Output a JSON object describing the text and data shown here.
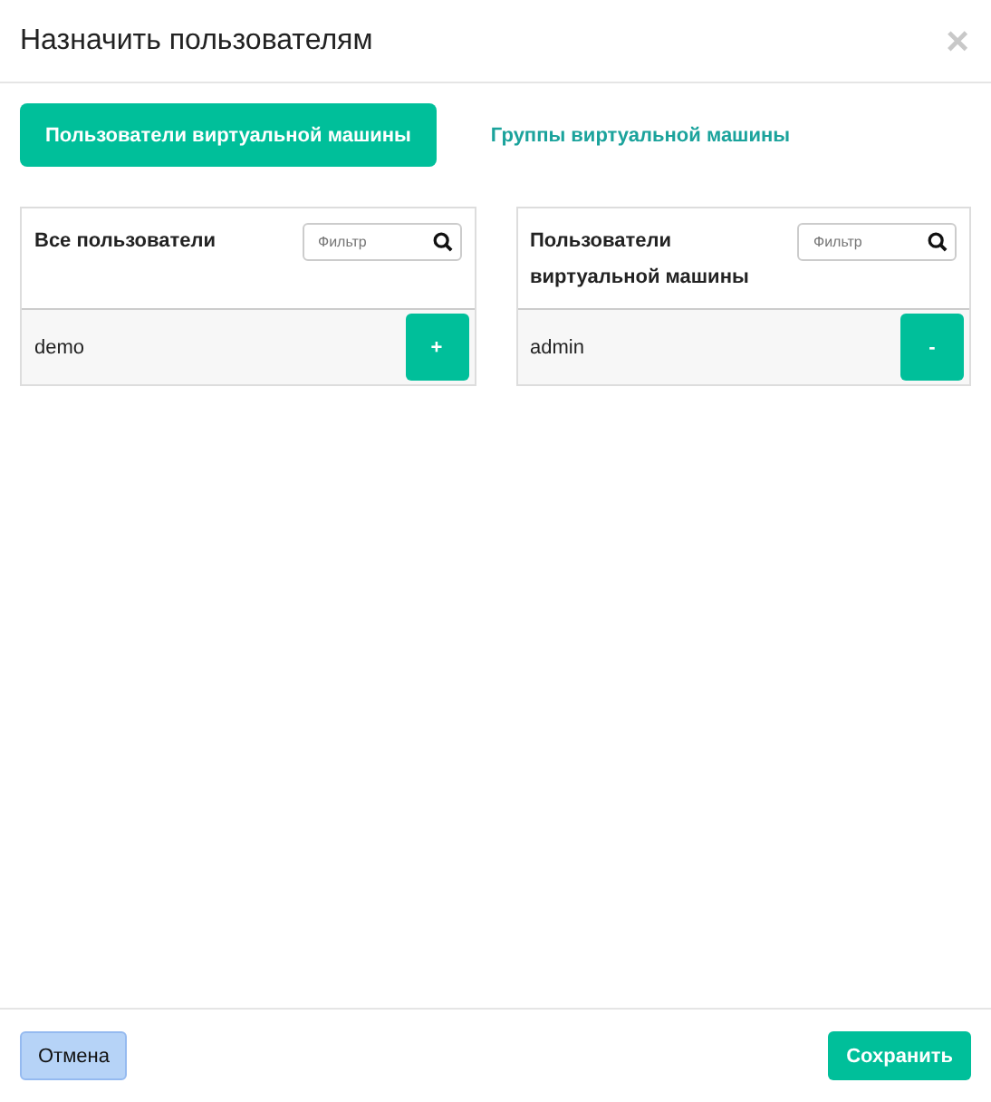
{
  "dialog": {
    "title": "Назначить пользователям",
    "close": "×"
  },
  "tabs": [
    {
      "label": "Пользователи виртуальной машины",
      "selected": true
    },
    {
      "label": "Группы виртуальной машины",
      "selected": false
    }
  ],
  "panels": [
    {
      "title": "Все пользователи",
      "filter": {
        "placeholder": "Фильтр"
      },
      "rows": [
        {
          "name": "demo",
          "action": "+"
        }
      ]
    },
    {
      "title": "Пользователи виртуальной машины",
      "filter": {
        "placeholder": "Фильтр"
      },
      "rows": [
        {
          "name": "admin",
          "action": "-"
        }
      ]
    }
  ],
  "footer": {
    "cancel": "Отмена",
    "save": "Сохранить"
  }
}
